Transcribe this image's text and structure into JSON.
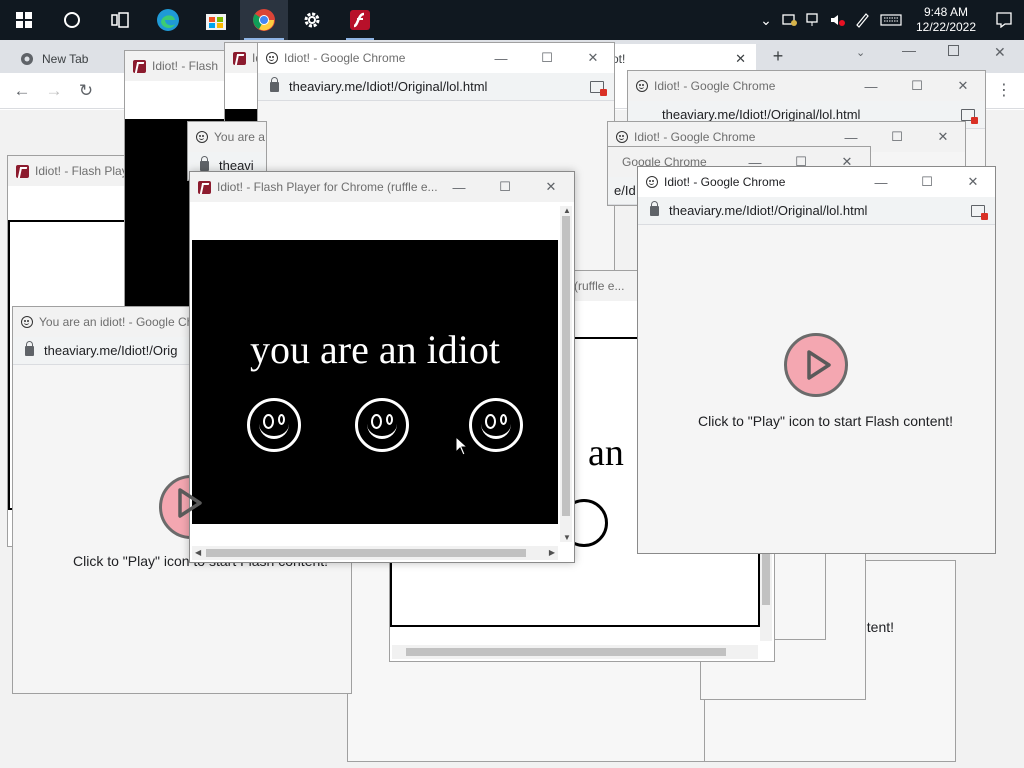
{
  "taskbar": {
    "apps": [
      "start",
      "search",
      "task-view",
      "edge",
      "store",
      "chrome",
      "settings",
      "flash"
    ],
    "time": "9:48 AM",
    "date": "12/22/2022"
  },
  "chrome": {
    "tab1_label": "New Tab",
    "tab2_label": "ot!"
  },
  "windows": {
    "w_left_flash_title": "Idiot! - Flash Play",
    "w_top_flash_title": "Idiot! - Flash",
    "w_top_flash2_title": "Id",
    "w_center_chrome_title": "Idiot! - Google Chrome",
    "w_center_chrome_url": "theaviary.me/Idiot!/Original/lol.html",
    "w_smiley_title": "You are a",
    "w_smiley_url": "theavi",
    "w_youare_title": "You are an idiot! - Google Ch",
    "w_youare_url": "theaviary.me/Idiot!/Orig",
    "w_right_back_title": "Idiot! - Google Chrome",
    "w_right_back_url": "theaviary.me/Idiot!/Original/lol.html",
    "w_right_mid_title": "Idiot! - Google Chrome",
    "w_right_mid2_title": "Google Chrome",
    "w_right_mid2_url": "e/Id",
    "w_ruffle_partial": "(ruffle e...",
    "w_main_right_title": "Idiot! - Google Chrome",
    "w_main_right_url": "theaviary.me/Idiot!/Original/lol.html",
    "flash_main_title": "Idiot! - Flash Player for Chrome (ruffle e...",
    "flash_message": "Click to \"Play\" icon to start Flash content!",
    "flash_message_partial": "Click to \"Play\" icon to start Flash content!",
    "bg_text_an": "an",
    "bg_text_ntent": "ntent!"
  },
  "flash_stage": {
    "text": "you are an idiot"
  }
}
